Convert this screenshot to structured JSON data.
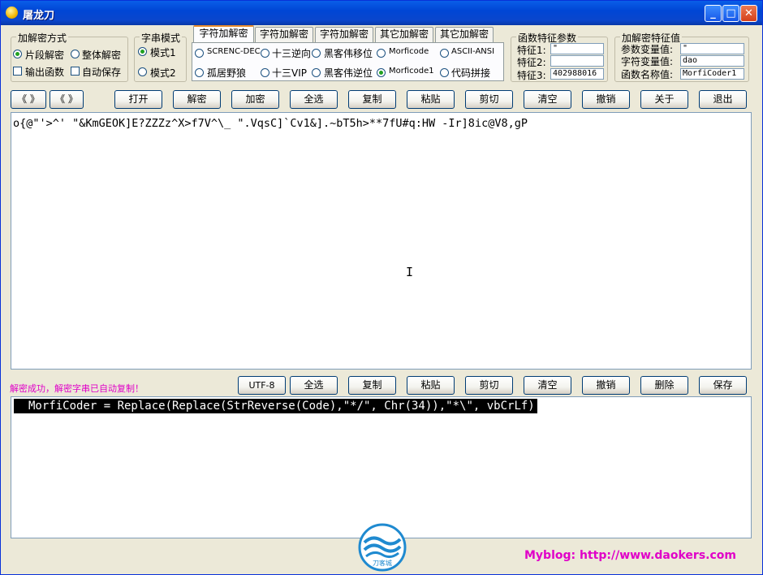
{
  "window": {
    "title": "屠龙刀"
  },
  "mode_group": {
    "label": "加解密方式",
    "segment": "片段解密",
    "whole": "整体解密",
    "output_func": "输出函数",
    "auto_save": "自动保存"
  },
  "string_mode": {
    "label": "字串模式",
    "mode1": "模式1",
    "mode2": "模式2"
  },
  "tabs": [
    "字符加解密",
    "字符加解密",
    "字符加解密",
    "其它加解密",
    "其它加解密"
  ],
  "algorithms": [
    "SCRENC-DEC",
    "十三逆向",
    "黑客伟移位",
    "Morficode",
    "ASCII-ANSI",
    "孤居野狼",
    "十三VIP",
    "黑客伟逆位",
    "Morficode1",
    "代码拼接"
  ],
  "func_params": {
    "label": "函数特征参数",
    "f1_label": "特征1:",
    "f1_value": "\"",
    "f2_label": "特征2:",
    "f2_value": "",
    "f3_label": "特征3:",
    "f3_value": "402988016"
  },
  "crypto_params": {
    "label": "加解密特征值",
    "param_label": "参数变量值:",
    "param_value": "\"",
    "string_label": "字符变量值:",
    "string_value": "dao",
    "func_label": "函数名称值:",
    "func_value": "MorfiCoder1"
  },
  "toolbar": {
    "prev": "《 》",
    "next": "《 》",
    "open": "打开",
    "decrypt": "解密",
    "encrypt": "加密",
    "select_all": "全选",
    "copy": "复制",
    "paste": "粘贴",
    "cut": "剪切",
    "clear": "清空",
    "undo": "撤销",
    "about": "关于",
    "exit": "退出"
  },
  "input_text": "o{@\"'>^' \"&KmGEOK]E?ZZZz^X>f7V^\\_ \".VqsC]`Cv1&].~bT5h>**7fU#q:HW -Ir]8ic@V8,gP",
  "status": "解密成功，解密字串已自动复制！",
  "toolbar2": {
    "utf8": "UTF-8",
    "select_all": "全选",
    "copy": "复制",
    "paste": "粘贴",
    "cut": "剪切",
    "clear": "清空",
    "undo": "撤销",
    "delete": "删除",
    "save": "保存"
  },
  "output_text": "MorfiCoder = Replace(Replace(StrReverse(Code),\"*/\", Chr(34)),\"*\\\", vbCrLf)",
  "footer": {
    "logo_text": "刀客城",
    "blog": "Myblog: http://www.daokers.com"
  },
  "colors": {
    "accent": "#e000c8",
    "titlebar": "#0a5ee8"
  }
}
